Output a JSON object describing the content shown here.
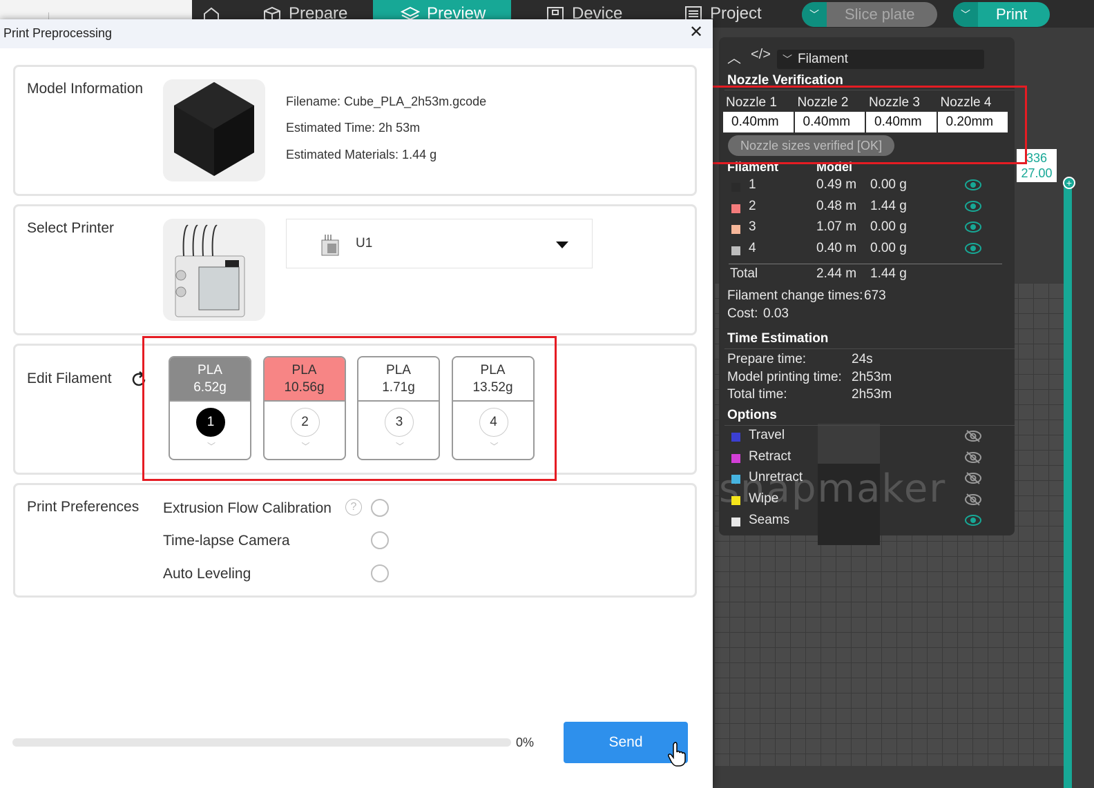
{
  "app": {
    "nav": [
      {
        "label": "Prepare",
        "icon": "cube-outline-icon"
      },
      {
        "label": "Preview",
        "icon": "layers-icon",
        "active": true
      },
      {
        "label": "Device",
        "icon": "device-icon"
      },
      {
        "label": "Project",
        "icon": "list-icon"
      }
    ],
    "slice_plate": "Slice plate",
    "print": "Print",
    "ruler_top": "336",
    "ruler_bottom": "27.00",
    "watermark": "snapmaker",
    "accent": "#17a896"
  },
  "stats": {
    "view_select": "Filament",
    "nozzle_title": "Nozzle Verification",
    "nozzles": [
      {
        "label": "Nozzle 1",
        "value": "0.40mm"
      },
      {
        "label": "Nozzle 2",
        "value": "0.40mm"
      },
      {
        "label": "Nozzle 3",
        "value": "0.40mm"
      },
      {
        "label": "Nozzle 4",
        "value": "0.20mm"
      }
    ],
    "verified": "Nozzle sizes verified [OK]",
    "col_filament": "Filament",
    "col_model": "Model",
    "filaments": [
      {
        "idx": "1",
        "color": "#2b2b2b",
        "length": "0.49 m",
        "weight": "0.00 g"
      },
      {
        "idx": "2",
        "color": "#f47c7c",
        "length": "0.48 m",
        "weight": "1.44 g"
      },
      {
        "idx": "3",
        "color": "#f7b79a",
        "length": "1.07 m",
        "weight": "0.00 g"
      },
      {
        "idx": "4",
        "color": "#bdbdbd",
        "length": "0.40 m",
        "weight": "0.00 g"
      }
    ],
    "total_label": "Total",
    "total_length": "2.44 m",
    "total_weight": "1.44 g",
    "change_times_label": "Filament change times:",
    "change_times": "673",
    "cost_label": "Cost:",
    "cost": "0.03",
    "time_title": "Time Estimation",
    "prepare_label": "Prepare time:",
    "prepare_value": "24s",
    "model_time_label": "Model printing time:",
    "model_time_value": "2h53m",
    "total_time_label": "Total time:",
    "total_time_value": "2h53m",
    "options_title": "Options",
    "options": [
      {
        "label": "Travel",
        "color": "#3b3fd1",
        "visible": false
      },
      {
        "label": "Retract",
        "color": "#d23fd6",
        "visible": false
      },
      {
        "label": "Unretract",
        "color": "#46b4e0",
        "visible": false
      },
      {
        "label": "Wipe",
        "color": "#f5e51b",
        "visible": false
      },
      {
        "label": "Seams",
        "color": "#e8e8e8",
        "visible": true
      }
    ]
  },
  "dialog": {
    "title": "Print Preprocessing",
    "model_info_label": "Model Information",
    "filename": "Filename: Cube_PLA_2h53m.gcode",
    "estimated_time": "Estimated Time: 2h 53m",
    "estimated_materials": "Estimated Materials: 1.44 g",
    "select_printer_label": "Select Printer",
    "printer_name": "U1",
    "edit_filament_label": "Edit Filament",
    "filament_slots": [
      {
        "type": "PLA",
        "weight": "6.52g",
        "num": "1",
        "bg": "#8a8a8a",
        "fg": "#ffffff",
        "filled": true
      },
      {
        "type": "PLA",
        "weight": "10.56g",
        "num": "2",
        "bg": "#f78585",
        "fg": "#333333",
        "filled": false
      },
      {
        "type": "PLA",
        "weight": "1.71g",
        "num": "3",
        "bg": "#ffffff",
        "fg": "#333333",
        "filled": false
      },
      {
        "type": "PLA",
        "weight": "13.52g",
        "num": "4",
        "bg": "#ffffff",
        "fg": "#333333",
        "filled": false
      }
    ],
    "print_prefs_label": "Print Preferences",
    "prefs": [
      {
        "label": "Extrusion Flow Calibration",
        "help": true,
        "checked": false
      },
      {
        "label": "Time-lapse Camera",
        "help": false,
        "checked": false
      },
      {
        "label": "Auto Leveling",
        "help": false,
        "checked": false
      }
    ],
    "help_glyph": "?",
    "progress_percent": 0,
    "progress_text": "0%",
    "send_label": "Send"
  }
}
